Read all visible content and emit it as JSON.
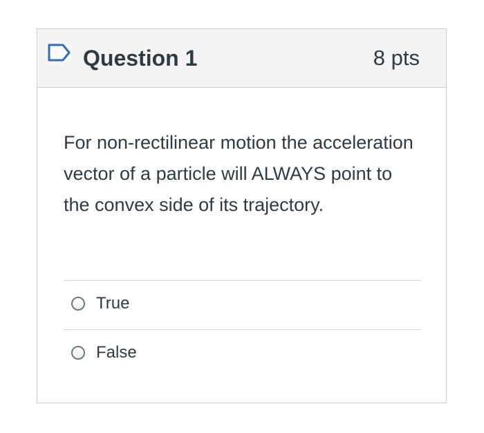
{
  "question": {
    "title": "Question 1",
    "points": "8 pts",
    "text": "For non-rectilinear motion the acceleration vector of a particle will ALWAYS point to the convex side of its trajectory.",
    "flag_icon": "flag-outline-icon",
    "accent_color": "#2f6fb7"
  },
  "answers": [
    {
      "label": "True",
      "selected": false
    },
    {
      "label": "False",
      "selected": false
    }
  ]
}
